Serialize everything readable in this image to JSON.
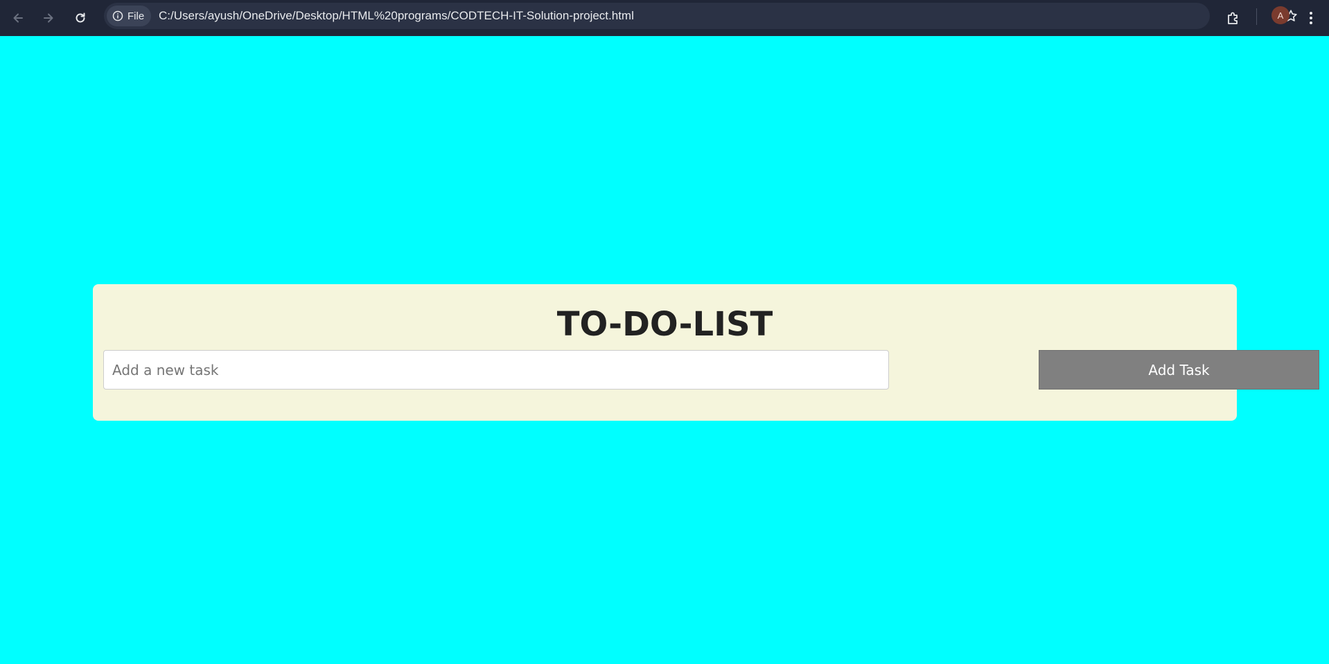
{
  "browser": {
    "site_chip_label": "File",
    "url": "C:/Users/ayush/OneDrive/Desktop/HTML%20programs/CODTECH-IT-Solution-project.html",
    "profile_initial": "A"
  },
  "page": {
    "background_color": "#00ffff",
    "card_color": "#f5f5dc",
    "title": "TO-DO-LIST",
    "task_input": {
      "value": "",
      "placeholder": "Add a new task"
    },
    "add_button_label": "Add Task",
    "add_button_color": "#808080"
  },
  "icons": {
    "back": "arrow-left-icon",
    "forward": "arrow-right-icon",
    "reload": "reload-icon",
    "info": "info-icon",
    "bookmark": "star-icon",
    "extensions": "puzzle-icon",
    "menu": "kebab-menu-icon"
  }
}
